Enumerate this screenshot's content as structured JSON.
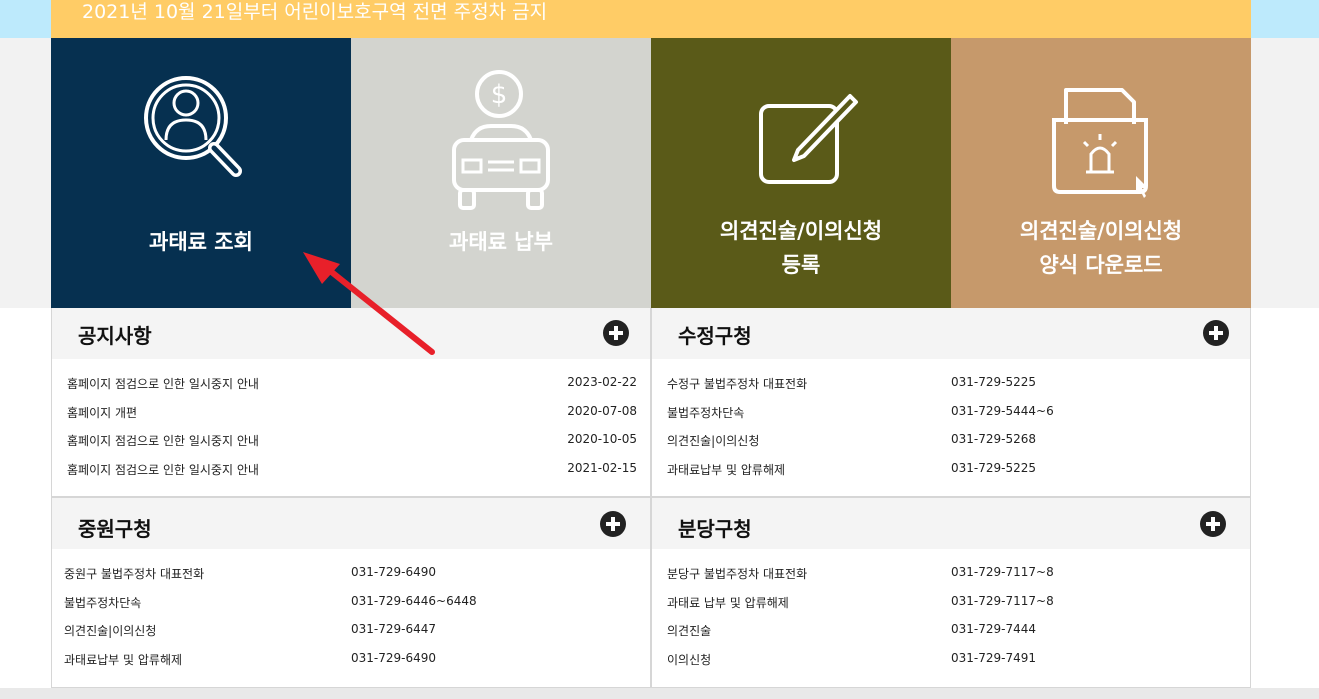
{
  "notice": {
    "text": "2021년 10월 21일부터 어린이보호구역 전면 주정차 금지"
  },
  "tiles": [
    {
      "label": "과태료 조회",
      "icon": "magnifier-person-icon",
      "color": "#063050"
    },
    {
      "label": "과태료 납부",
      "icon": "car-dollar-icon",
      "color": "#d3d4cf"
    },
    {
      "label_line1": "의견진술/이의신청",
      "label_line2": "등록",
      "icon": "edit-pencil-icon",
      "color": "#5a5a18"
    },
    {
      "label_line1": "의견진술/이의신청",
      "label_line2": "양식 다운로드",
      "icon": "folder-siren-download-icon",
      "color": "#c6996b"
    }
  ],
  "panels": {
    "notice_board": {
      "title": "공지사항",
      "rows": [
        {
          "text": "홈페이지 점검으로 인한 일시중지 안내",
          "value": "2023-02-22"
        },
        {
          "text": "홈페이지 개편",
          "value": "2020-07-08"
        },
        {
          "text": "홈페이지 점검으로 인한 일시중지 안내",
          "value": "2020-10-05"
        },
        {
          "text": "홈페이지 점검으로 인한 일시중지 안내",
          "value": "2021-02-15"
        }
      ]
    },
    "sujeong": {
      "title": "수정구청",
      "rows": [
        {
          "text": "수정구 불법주정차 대표전화",
          "value": "031-729-5225"
        },
        {
          "text": "불법주정차단속",
          "value": "031-729-5444~6"
        },
        {
          "text": "의견진술|이의신청",
          "value": "031-729-5268"
        },
        {
          "text": "과태료납부 및 압류해제",
          "value": "031-729-5225"
        }
      ]
    },
    "jungwon": {
      "title": "중원구청",
      "rows": [
        {
          "text": "중원구 불법주정차 대표전화",
          "value": "031-729-6490"
        },
        {
          "text": "불법주정차단속",
          "value": "031-729-6446~6448"
        },
        {
          "text": "의견진술|이의신청",
          "value": "031-729-6447"
        },
        {
          "text": "과태료납부 및 압류해제",
          "value": "031-729-6490"
        }
      ]
    },
    "bundang": {
      "title": "분당구청",
      "rows": [
        {
          "text": "분당구 불법주정차 대표전화",
          "value": "031-729-7117~8"
        },
        {
          "text": "과태료 납부 및 압류해제",
          "value": "031-729-7117~8"
        },
        {
          "text": "의견진술",
          "value": "031-729-7444"
        },
        {
          "text": "이의신청",
          "value": "031-729-7491"
        }
      ]
    }
  },
  "colors": {
    "accent_red": "#e8202a"
  }
}
